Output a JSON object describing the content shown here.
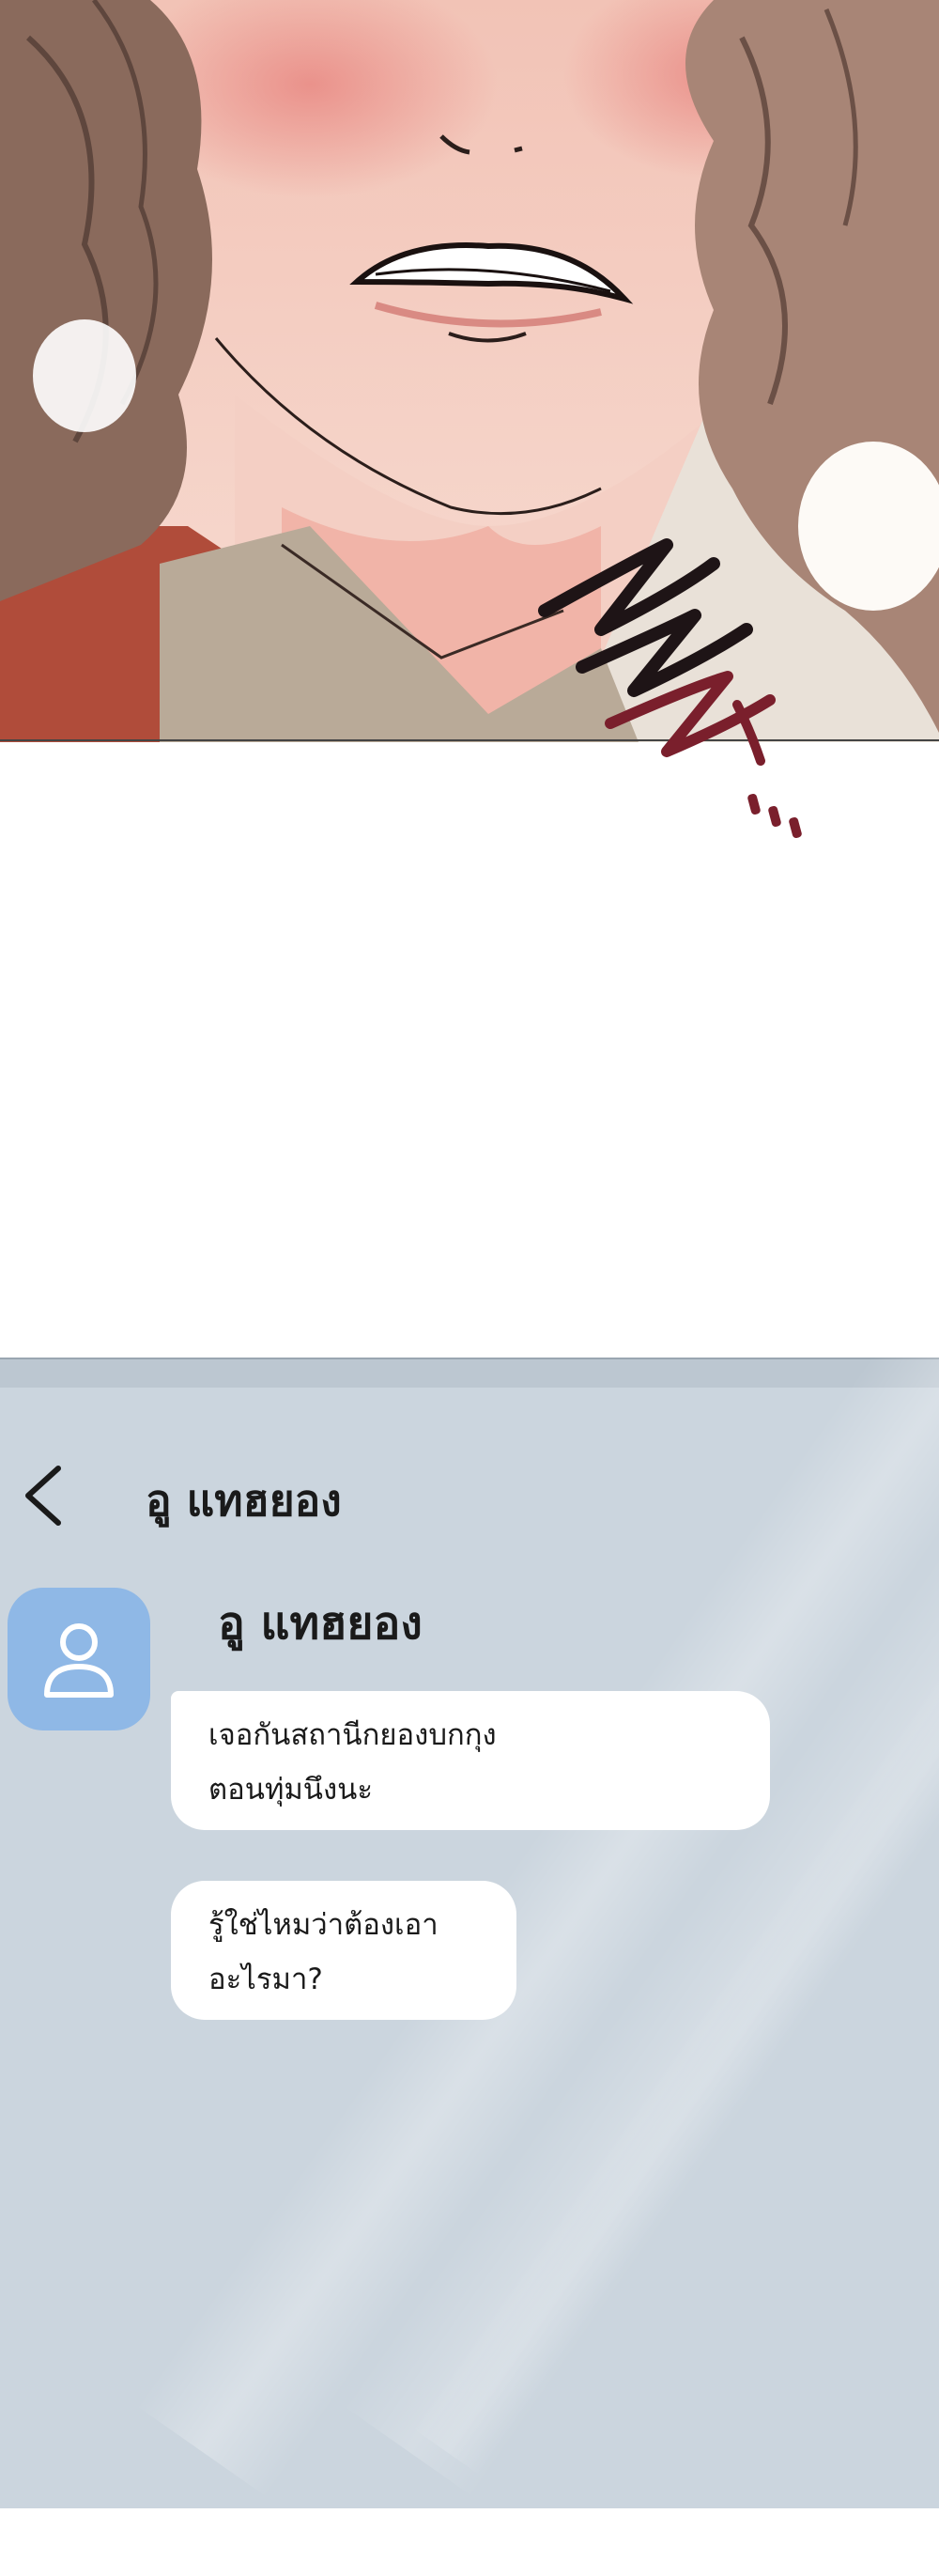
{
  "comic": {
    "sfx_icon": "teeth-grind-sfx",
    "colors": {
      "skin": "#f4cfc3",
      "blush": "#e9908a",
      "hair": "#8a6a5c",
      "shirt": "#b04c3a",
      "robe": "#b9aa98",
      "sfx": "#7a1f2c"
    }
  },
  "chat": {
    "back_icon": "chevron-left-icon",
    "header_title": "อู แทฮยอง",
    "avatar_icon": "person-icon",
    "sender_name": "อู แทฮยอง",
    "messages": [
      {
        "lines": [
          "เจอกันสถานีกยองบกกุง",
          "ตอนทุ่มนึงนะ"
        ]
      },
      {
        "lines": [
          "รู้ใช่ไหมว่าต้องเอา",
          "อะไรมา?"
        ]
      }
    ],
    "colors": {
      "background": "#cbd5de",
      "avatar": "#8fb8e6",
      "bubble": "#ffffff"
    }
  }
}
